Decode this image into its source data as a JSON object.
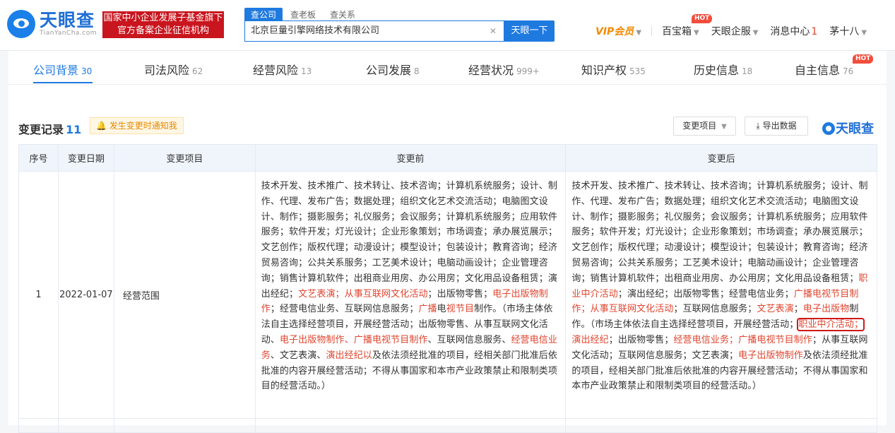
{
  "header": {
    "logo_cn": "天眼查",
    "logo_en": "TianYanCha.com",
    "badge_line1": "国家中小企业发展子基金旗下",
    "badge_line2": "官方备案企业征信机构",
    "search_tabs": [
      "查公司",
      "查老板",
      "查关系"
    ],
    "search_value": "北京巨量引擎网络技术有限公司",
    "search_button": "天眼一下",
    "nav": {
      "vip": "VIP会员",
      "baobox": "百宝箱",
      "hot": "HOT",
      "qifu": "天眼企服",
      "msg": "消息中心",
      "msg_count": "1",
      "user": "茅十八"
    }
  },
  "tabs": [
    {
      "label": "公司背景",
      "count": "30"
    },
    {
      "label": "司法风险",
      "count": "62"
    },
    {
      "label": "经营风险",
      "count": "13"
    },
    {
      "label": "公司发展",
      "count": "8"
    },
    {
      "label": "经营状况",
      "count": "999+"
    },
    {
      "label": "知识产权",
      "count": "535"
    },
    {
      "label": "历史信息",
      "count": "18"
    },
    {
      "label": "自主信息",
      "count": "76"
    }
  ],
  "tab_hot": "HOT",
  "section": {
    "title": "变更记录",
    "count": "11",
    "notify": "发生变更时通知我",
    "filter_button": "变更项目",
    "export_button": "导出数据",
    "brand": "天眼查"
  },
  "table": {
    "headers": [
      "序号",
      "变更日期",
      "变更项目",
      "变更前",
      "变更后"
    ],
    "row": {
      "index": "1",
      "date": "2022-01-07",
      "item": "经营范围",
      "before": [
        {
          "t": "技术开发、技术推广、技术转让、技术咨询；计算机系统服务；设计、制作、代理、发布广告；数据处理；组织文化艺术交流活动；电脑图文设计、制作；摄影服务；礼仪服务；会议服务；计算机系统服务；应用软件服务；软件开发；灯光设计；企业形象策划；市场调查；承办展览展示；文艺创作；版权代理；动漫设计；模型设计；包装设计；教育咨询；经济贸易咨询；公共关系服务；工艺美术设计；电脑动画设计；企业管理咨询；销售计算机软件；出租商业用房、办公用房；文化用品设备租赁；演出经纪；"
        },
        {
          "t": "文艺表演；从事互联网文化活动",
          "r": true
        },
        {
          "t": "；出版物零售；"
        },
        {
          "t": "电子出版物制作",
          "r": true
        },
        {
          "t": "；经营电信业务、互联网信息服务；"
        },
        {
          "t": "广播",
          "r": true
        },
        {
          "t": "电"
        },
        {
          "t": "视节目",
          "r": true
        },
        {
          "t": "制作。（市场主体依法自主选择经营项目，开展经营活动；出版物零售、从事互联网文化活动、"
        },
        {
          "t": "电子出版物制作、广播电视节目制作",
          "r": true
        },
        {
          "t": "、互联网信息服务、"
        },
        {
          "t": "经营电信业务",
          "r": true
        },
        {
          "t": "、文艺表演、"
        },
        {
          "t": "演出经纪以",
          "r": true
        },
        {
          "t": "及依法须经批准的项目，经相关部门批准后依批准的内容开展经营活动；不得从事国家和本市产业政策禁止和限制类项目的经营活动。）"
        }
      ],
      "after": [
        {
          "t": "技术开发、技术推广、技术转让、技术咨询；计算机系统服务；设计、制作、代理、发布广告；数据处理；组织文化艺术交流活动；电脑图文设计、制作；摄影服务；礼仪服务；会议服务；计算机系统服务；应用软件服务；软件开发；灯光设计；企业形象策划；市场调查；承办展览展示；文艺创作；版权代理；动漫设计；模型设计；包装设计；教育咨询；经济贸易咨询；公共关系服务；工艺美术设计；电脑动画设计；企业管理咨询；销售计算机软件；出租商业用房、办公用房；文化用品设备租赁；"
        },
        {
          "t": "职业中介活动",
          "r": true
        },
        {
          "t": "；演出经纪；出版物零售；经营电信业务；"
        },
        {
          "t": "广播电视节目制作；从事互联网文化活动",
          "r": true
        },
        {
          "t": "；互联网信息服务；"
        },
        {
          "t": "文艺表演",
          "r": true
        },
        {
          "t": "；"
        },
        {
          "t": "电子出版物",
          "r": true
        },
        {
          "t": "制作。（市场主体依法自主选择经营项目，开展经营活动；"
        },
        {
          "t": "职业中介活动；",
          "r": true,
          "box": true
        },
        {
          "t": "演出经纪",
          "r": true
        },
        {
          "t": "；出版物零售；"
        },
        {
          "t": "经营电信业务；广播电视节目制作",
          "r": true
        },
        {
          "t": "；从事互联网文化活动；互联网信息服务；文艺表演；"
        },
        {
          "t": "电子出版物制作",
          "r": true
        },
        {
          "t": "及依法须经批准的项目，经相关部门批准后依批准的内容开展经营活动；不得从事国家和本市产业政策禁止和限制类项目的经营活动。）"
        }
      ]
    }
  }
}
